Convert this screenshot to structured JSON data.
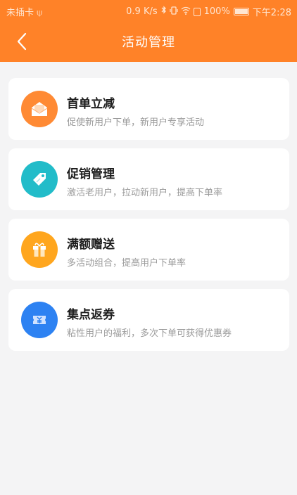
{
  "status_bar": {
    "carrier": "未插卡 ⍦",
    "speed": "0.9 K/s",
    "battery": "100%",
    "time": "下午2:28",
    "battery_level": 1.0
  },
  "header": {
    "title": "活动管理",
    "color": "#ff8228"
  },
  "activities": [
    {
      "title": "首单立减",
      "desc": "促使新用户下单，新用户专享活动",
      "icon": "envelope-icon",
      "color": "#ff8a34"
    },
    {
      "title": "促销管理",
      "desc": "激活老用户，拉动新用户，提高下单率",
      "icon": "tag-icon",
      "color": "#22bcc9"
    },
    {
      "title": "满额赠送",
      "desc": "多活动组合，提高用户下单率",
      "icon": "gift-icon",
      "color": "#ffa61e"
    },
    {
      "title": "集点返券",
      "desc": "粘性用户的福利，多次下单可获得优惠券",
      "icon": "coupon-icon",
      "color": "#2d82f2"
    }
  ]
}
